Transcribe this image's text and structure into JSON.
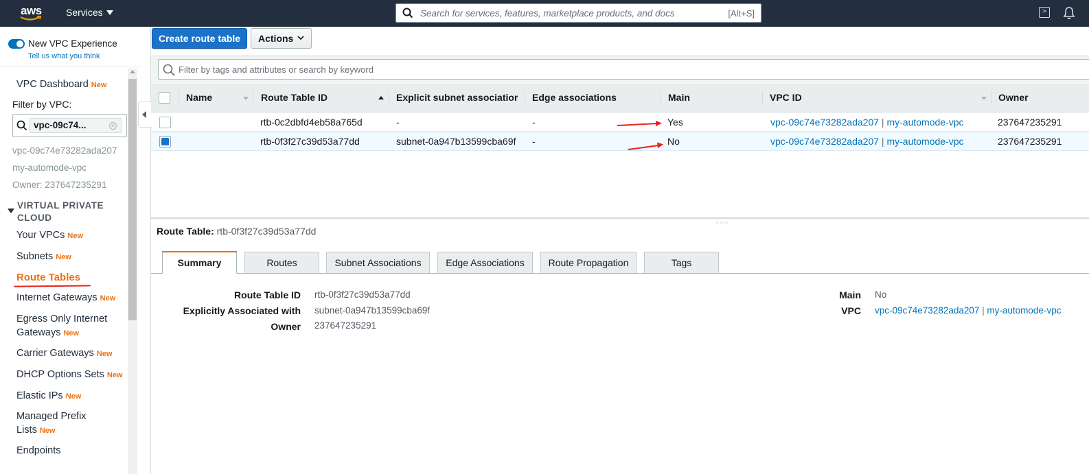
{
  "topnav": {
    "logo": "aws",
    "services_label": "Services",
    "search_placeholder": "Search for services, features, marketplace products, and docs",
    "search_shortcut": "[Alt+S]",
    "icons": [
      "cloudshell-icon",
      "bell-icon"
    ]
  },
  "sidebar": {
    "toggle_label": "New VPC Experience",
    "toggle_on": true,
    "tell_us": "Tell us what you think",
    "dashboard": {
      "label": "VPC Dashboard",
      "badge": "New"
    },
    "filter_label": "Filter by VPC:",
    "filter_chip": "vpc-09c74...",
    "vpc_id": "vpc-09c74e73282ada207",
    "vpc_name": "my-automode-vpc",
    "vpc_owner": "Owner: 237647235291",
    "section_title": "VIRTUAL PRIVATE CLOUD",
    "items": [
      {
        "label": "Your VPCs",
        "badge": "New"
      },
      {
        "label": "Subnets",
        "badge": "New"
      },
      {
        "label": "Route Tables",
        "badge": ""
      },
      {
        "label": "Internet Gateways",
        "badge": "New"
      },
      {
        "label": "Egress Only Internet Gateways",
        "label_line1": "Egress Only Internet",
        "label_line2": "Gateways",
        "badge": "New"
      },
      {
        "label": "Carrier Gateways",
        "badge": "New"
      },
      {
        "label": "DHCP Options Sets",
        "badge": "New"
      },
      {
        "label": "Elastic IPs",
        "badge": "New"
      },
      {
        "label": "Managed Prefix Lists",
        "label_line1": "Managed Prefix",
        "label_line2": "Lists",
        "badge": "New"
      },
      {
        "label": "Endpoints",
        "badge": ""
      }
    ]
  },
  "toolbar": {
    "create_label": "Create route table",
    "actions_label": "Actions"
  },
  "table": {
    "filter_placeholder": "Filter by tags and attributes or search by keyword",
    "columns": [
      "Name",
      "Route Table ID",
      "Explicit subnet associatior",
      "Edge associations",
      "Main",
      "VPC ID",
      "Owner"
    ],
    "rows": [
      {
        "selected": false,
        "name": "",
        "route_table_id": "rtb-0c2dbfd4eb58a765d",
        "subnet": "-",
        "edge": "-",
        "main": "Yes",
        "vpc_id": "vpc-09c74e73282ada207",
        "vpc_sep": " | ",
        "vpc_name": "my-automode-vpc",
        "owner": "237647235291"
      },
      {
        "selected": true,
        "name": "",
        "route_table_id": "rtb-0f3f27c39d53a77dd",
        "subnet": "subnet-0a947b13599cba69f",
        "edge": "-",
        "main": "No",
        "vpc_id": "vpc-09c74e73282ada207",
        "vpc_sep": " | ",
        "vpc_name": "my-automode-vpc",
        "owner": "237647235291"
      }
    ]
  },
  "detail": {
    "title_label": "Route Table:",
    "title_value": "rtb-0f3f27c39d53a77dd",
    "tabs": [
      "Summary",
      "Routes",
      "Subnet Associations",
      "Edge Associations",
      "Route Propagation",
      "Tags"
    ],
    "active_tab": "Summary",
    "fields_left": [
      {
        "label": "Route Table ID",
        "value": "rtb-0f3f27c39d53a77dd"
      },
      {
        "label": "Explicitly Associated with",
        "value": "subnet-0a947b13599cba69f"
      },
      {
        "label": "Owner",
        "value": "237647235291"
      }
    ],
    "fields_right": [
      {
        "label": "Main",
        "value": "No"
      },
      {
        "label": "VPC",
        "vpc_id": "vpc-09c74e73282ada207",
        "sep": " | ",
        "vpc_name": "my-automode-vpc"
      }
    ]
  },
  "colors": {
    "nav_bg": "#232f3e",
    "primary": "#1a73c9",
    "link": "#0073bb",
    "badge": "#ec7211",
    "annotation": "#e8231b"
  }
}
